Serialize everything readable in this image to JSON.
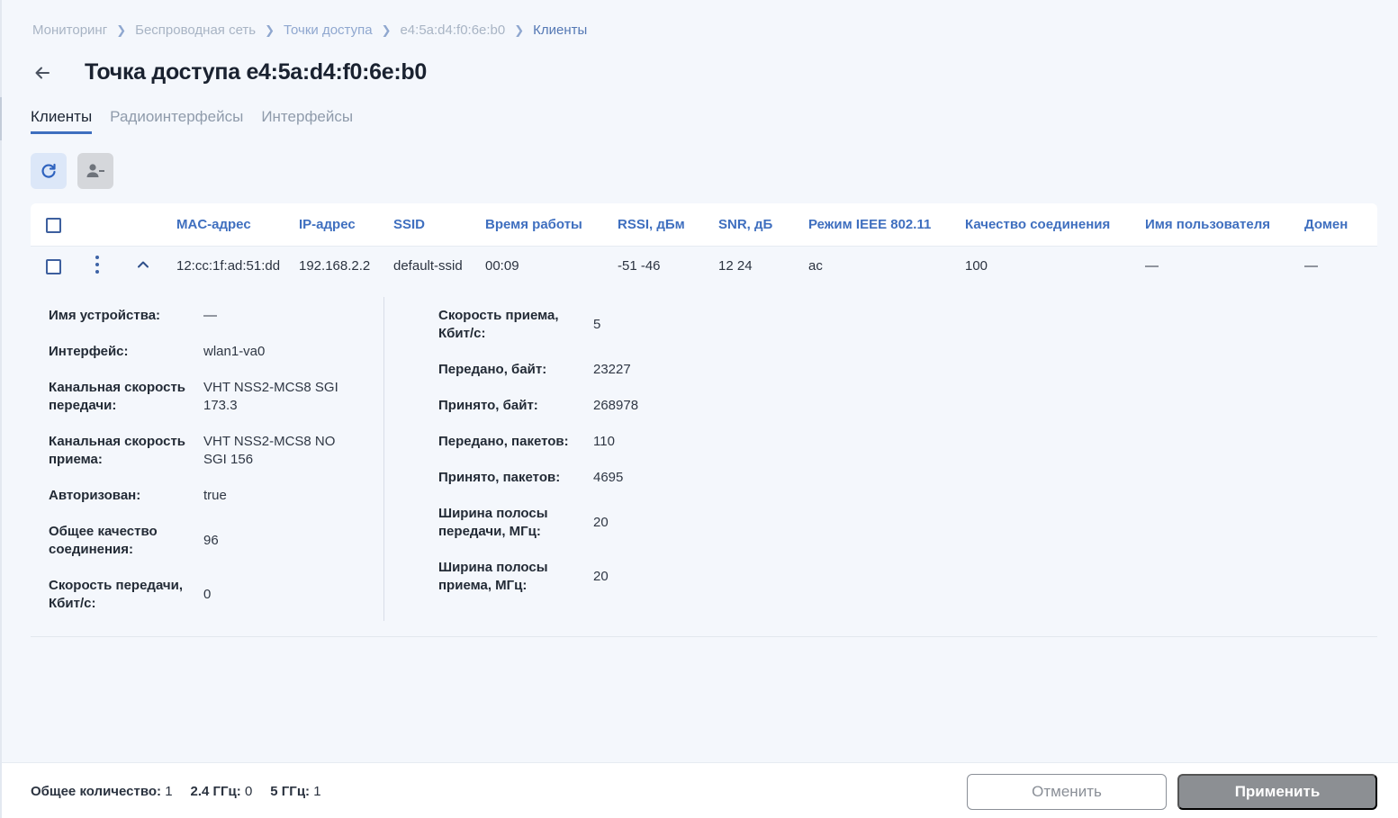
{
  "breadcrumb": {
    "items": [
      "Мониторинг",
      "Беспроводная сеть",
      "Точки доступа",
      "e4:5a:d4:f0:6e:b0",
      "Клиенты"
    ]
  },
  "header": {
    "title": "Точка доступа e4:5a:d4:f0:6e:b0"
  },
  "tabs": [
    {
      "label": "Клиенты"
    },
    {
      "label": "Радиоинтерфейсы"
    },
    {
      "label": "Интерфейсы"
    }
  ],
  "table": {
    "columns": [
      "MAC-адрес",
      "IP-адрес",
      "SSID",
      "Время работы",
      "RSSI, дБм",
      "SNR, дБ",
      "Режим IEEE 802.11",
      "Качество соединения",
      "Имя пользователя",
      "Домен"
    ],
    "rows": [
      {
        "mac": "12:cc:1f:ad:51:dd",
        "ip": "192.168.2.2",
        "ssid": "default-ssid",
        "uptime": "00:09",
        "rssi": "-51 -46",
        "snr": "12 24",
        "mode": "ac",
        "quality": "100",
        "user": "—",
        "domain": "—"
      }
    ]
  },
  "details": {
    "left": [
      {
        "label": "Имя устройства:",
        "value": "—"
      },
      {
        "label": "Интерфейс:",
        "value": "wlan1-va0"
      },
      {
        "label": "Канальная скорость передачи:",
        "value": "VHT NSS2-MCS8 SGI 173.3"
      },
      {
        "label": "Канальная скорость приема:",
        "value": "VHT NSS2-MCS8 NO SGI 156"
      },
      {
        "label": "Авторизован:",
        "value": "true"
      },
      {
        "label": "Общее качество соединения:",
        "value": "96"
      },
      {
        "label": "Скорость передачи, Кбит/с:",
        "value": "0"
      }
    ],
    "right": [
      {
        "label": "Скорость приема, Кбит/с:",
        "value": "5"
      },
      {
        "label": "Передано, байт:",
        "value": "23227"
      },
      {
        "label": "Принято, байт:",
        "value": "268978"
      },
      {
        "label": "Передано, пакетов:",
        "value": "110"
      },
      {
        "label": "Принято, пакетов:",
        "value": "4695"
      },
      {
        "label": "Ширина полосы передачи, МГц:",
        "value": "20"
      },
      {
        "label": "Ширина полосы приема, МГц:",
        "value": "20"
      }
    ]
  },
  "footer": {
    "total_label": "Общее количество:",
    "total_value": "1",
    "band24_label": "2.4 ГГц:",
    "band24_value": "0",
    "band5_label": "5 ГГц:",
    "band5_value": "1",
    "cancel_label": "Отменить",
    "apply_label": "Применить"
  },
  "icons": {
    "back": "arrow-left-icon",
    "refresh": "refresh-icon",
    "remove_user": "user-minus-icon",
    "row_menu": "kebab-menu-icon",
    "collapse": "chevron-up-icon"
  },
  "colors": {
    "accent": "#3f6fbf",
    "background": "#f4f7fc",
    "button_disabled": "#8c8f93"
  }
}
